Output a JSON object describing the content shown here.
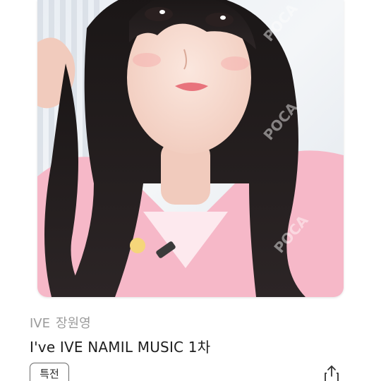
{
  "product": {
    "group": "IVE",
    "member": "장원영",
    "title": "I've IVE NAMIL MUSIC 1차",
    "badge": "특전"
  },
  "watermark": "POCA",
  "icons": {
    "share": "share-icon"
  },
  "colors": {
    "title_text": "#1e1e1e",
    "meta_text": "#9b9b9b",
    "badge_border": "#6a6a6a"
  }
}
